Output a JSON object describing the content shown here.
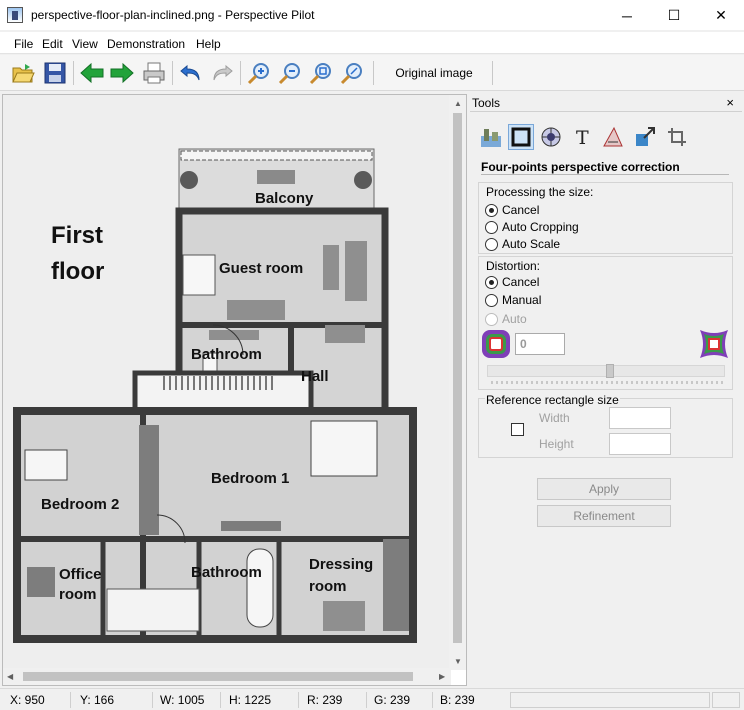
{
  "window": {
    "title": "perspective-floor-plan-inclined.png - Perspective Pilot",
    "minimize_glyph": "─",
    "maximize_glyph": "☐",
    "close_glyph": "✕"
  },
  "menu": {
    "items": [
      "File",
      "Edit",
      "View",
      "Demonstration",
      "Help"
    ]
  },
  "toolbar": {
    "icons": [
      "open-folder-icon",
      "save-icon",
      "back-arrow-icon",
      "forward-arrow-icon",
      "print-icon",
      "undo-icon",
      "redo-icon",
      "zoom-in-icon",
      "zoom-out-icon",
      "zoom-fit-icon",
      "zoom-actual-icon"
    ],
    "original_image_label": "Original image"
  },
  "floor_plan": {
    "heading_line1": "First",
    "heading_line2": "floor",
    "rooms": {
      "balcony": "Balcony",
      "guest_room": "Guest room",
      "bathroom_top": "Bathroom",
      "hall": "Hall",
      "bedroom1": "Bedroom 1",
      "bedroom2": "Bedroom 2",
      "office_line1": "Office",
      "office_line2": "room",
      "bathroom_bottom": "Bathroom",
      "dressing_line1": "Dressing",
      "dressing_line2": "room"
    }
  },
  "tools": {
    "title": "Tools",
    "close_glyph": "×",
    "tool_icons": [
      "landscape-icon",
      "rectangle-correction-icon",
      "sphere-icon",
      "text-icon",
      "triangle-ruler-icon",
      "resize-icon",
      "crop-icon"
    ],
    "section_title": "Four-points perspective correction",
    "processing": {
      "label": "Processing the size:",
      "options": [
        "Cancel",
        "Auto Cropping",
        "Auto Scale"
      ],
      "selected": "Cancel"
    },
    "distortion": {
      "label": "Distortion:",
      "options": [
        "Cancel",
        "Manual",
        "Auto"
      ],
      "selected": "Cancel",
      "value": "0",
      "level": 0.5
    },
    "reference": {
      "label": "Reference rectangle size",
      "width_label": "Width",
      "height_label": "Height"
    },
    "apply_label": "Apply",
    "refinement_label": "Refinement"
  },
  "status": {
    "x": "X: 950",
    "y": "Y: 166",
    "w": "W: 1005",
    "h": "H: 1225",
    "r": "R: 239",
    "g": "G: 239",
    "b": "B: 239"
  },
  "colors": {
    "accent": "#1e90ff",
    "green_arrow": "#22a33a",
    "undo_blue": "#2b6fcf"
  }
}
